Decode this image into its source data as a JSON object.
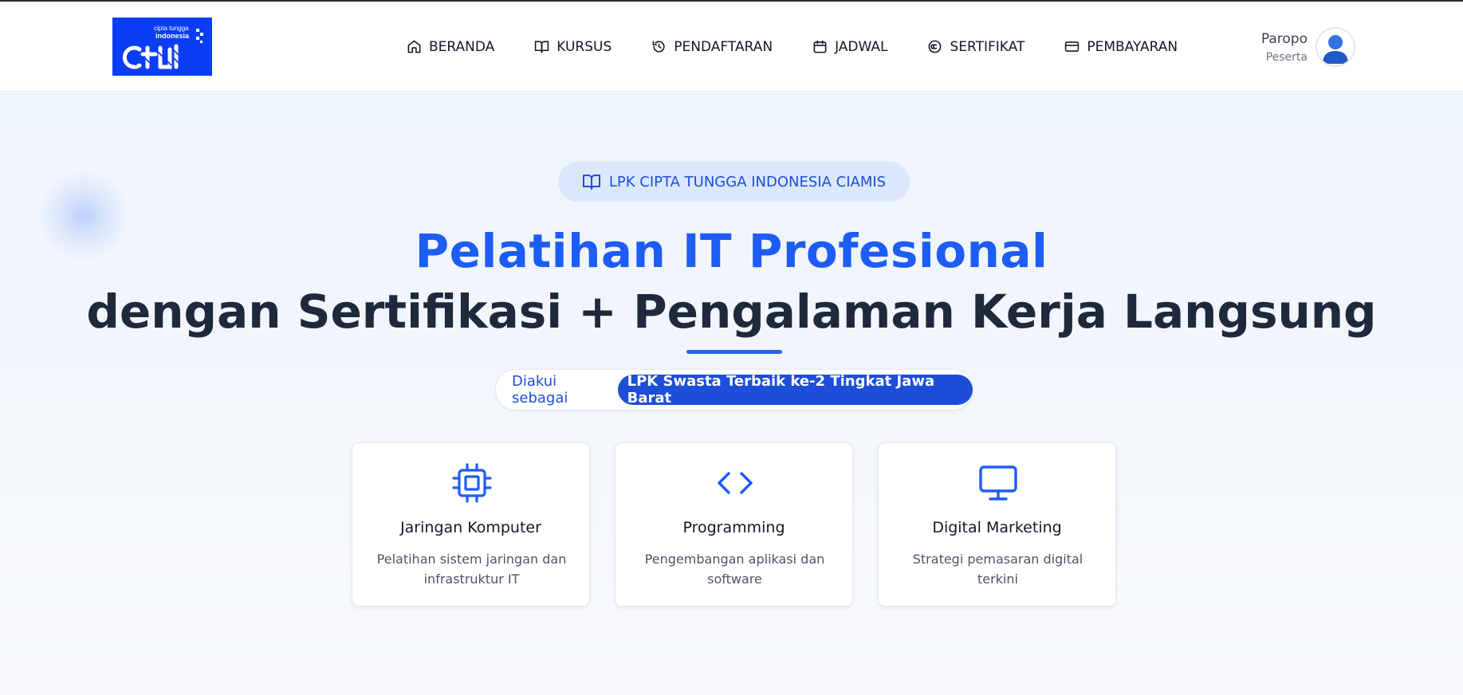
{
  "colors": {
    "brand_blue": "#0a3df5",
    "accent": "#1d5cf5",
    "dark_text": "#1e293b"
  },
  "header": {
    "logo": {
      "small_line1": "cipta tungga",
      "small_line2": "indonesia",
      "icon": "cti-logo-icon"
    },
    "nav": [
      {
        "label": "BERANDA",
        "icon": "home-icon"
      },
      {
        "label": "KURSUS",
        "icon": "book-open-icon"
      },
      {
        "label": "PENDAFTARAN",
        "icon": "history-icon"
      },
      {
        "label": "JADWAL",
        "icon": "calendar-icon"
      },
      {
        "label": "SERTIFIKAT",
        "icon": "copyright-icon"
      },
      {
        "label": "PEMBAYARAN",
        "icon": "credit-card-icon"
      }
    ],
    "user": {
      "name": "Paropo",
      "role": "Peserta",
      "icon": "user-avatar-icon"
    }
  },
  "hero": {
    "badge": "LPK CIPTA TUNGGA INDONESIA CIAMIS",
    "title_line1": "Pelatihan IT Profesional",
    "title_line2": "dengan Sertifikasi + Pengalaman Kerja Langsung",
    "recognition_prefix": "Diakui sebagai",
    "recognition_highlight": "LPK Swasta Terbaik ke-2 Tingkat Jawa Barat"
  },
  "cards": [
    {
      "title": "Jaringan Komputer",
      "desc": "Pelatihan sistem jaringan dan infrastruktur IT",
      "icon": "cpu-icon"
    },
    {
      "title": "Programming",
      "desc": "Pengembangan aplikasi dan software",
      "icon": "code-icon"
    },
    {
      "title": "Digital Marketing",
      "desc": "Strategi pemasaran digital terkini",
      "icon": "monitor-icon"
    }
  ]
}
